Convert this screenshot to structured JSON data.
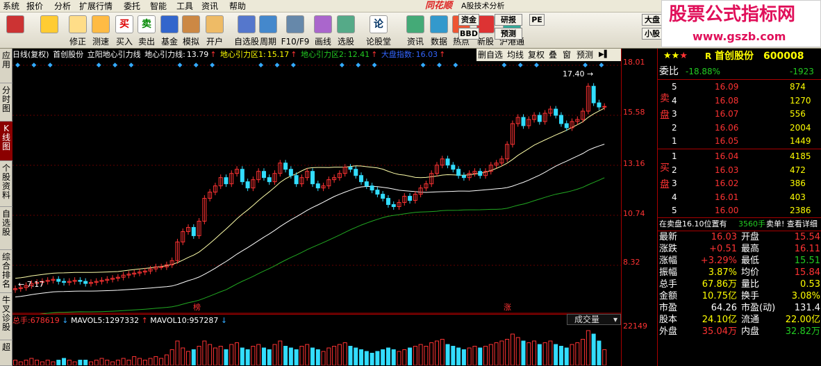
{
  "menu": [
    "系统",
    "报价",
    "分析",
    "扩展行情",
    "委托",
    "智能",
    "工具",
    "资讯",
    "帮助"
  ],
  "brand": "同花顺",
  "app_title": "A股技术分析",
  "toolbar": {
    "buttons": [
      {
        "label": "",
        "icon": "grid-icon"
      },
      {
        "label": "",
        "icon": "back-arrow-icon"
      },
      {
        "label": "修正",
        "icon": "arrows-icon"
      },
      {
        "label": "测速",
        "icon": "speed-icon"
      },
      {
        "label": "买入",
        "icon": "buy-icon",
        "glyph": "买"
      },
      {
        "label": "卖出",
        "icon": "sell-icon",
        "glyph": "卖"
      },
      {
        "label": "基金",
        "icon": "fund-icon"
      },
      {
        "label": "模拟",
        "icon": "hammer-icon"
      },
      {
        "label": "开户",
        "icon": "lock-icon"
      },
      {
        "label": "自选股",
        "icon": "star-icon"
      },
      {
        "label": "周期",
        "icon": "clock-icon"
      },
      {
        "label": "F10/F9",
        "icon": "f10-icon"
      },
      {
        "label": "画线",
        "icon": "pencil-icon"
      },
      {
        "label": "选股",
        "icon": "filter-icon"
      },
      {
        "label": "论股堂",
        "icon": "forum-icon",
        "glyph": "论"
      },
      {
        "label": "资讯",
        "icon": "news-icon"
      },
      {
        "label": "数据",
        "icon": "data-icon"
      },
      {
        "label": "热点",
        "icon": "hot-icon"
      },
      {
        "label": "新股",
        "icon": "newstock-icon"
      },
      {
        "label": "沪港通",
        "icon": "hk-icon"
      }
    ],
    "small": [
      "资金",
      "BBD",
      "研报",
      "预测",
      "PE",
      "大盘",
      "小股"
    ]
  },
  "watermark": {
    "line1": "股票公式指标网",
    "line2": "www.gszb.com"
  },
  "left_tabs": [
    "应用",
    "分时图",
    "K线图",
    "个股资料",
    "自选股",
    "综合排名",
    "牛叉诊股",
    "超"
  ],
  "chart_info": {
    "period": "日线(复权)",
    "stock": "首创股份",
    "indicator": "立阳地心引力线",
    "items": [
      {
        "label": "地心引力线:",
        "value": "13.79",
        "color": "#ffffff"
      },
      {
        "label": "地心引力区1:",
        "value": "15.17",
        "color": "#ffff00"
      },
      {
        "label": "地心引力区2:",
        "value": "12.41",
        "color": "#22cc22"
      },
      {
        "label": "大盘指数:",
        "value": "16.03",
        "color": "#3366ff"
      }
    ]
  },
  "chart_tools": [
    "删自选",
    "均线",
    "复权",
    "叠",
    "窗",
    "预测"
  ],
  "y_axis": [
    "18.01",
    "15.58",
    "13.16",
    "10.74",
    "8.32"
  ],
  "vol_y": "22149",
  "chart_data": {
    "type": "candlestick",
    "high_label": "17.40",
    "low_label": "7.17",
    "markers": [
      "榜",
      "涨"
    ],
    "ylim": [
      7.17,
      18.01
    ],
    "close": [
      7.25,
      7.3,
      7.4,
      7.5,
      7.55,
      7.6,
      7.65,
      7.7,
      7.6,
      7.55,
      7.6,
      7.65,
      7.6,
      7.5,
      7.55,
      7.6,
      7.65,
      7.7,
      7.75,
      7.8,
      7.9,
      7.95,
      8.0,
      8.05,
      8.1,
      8.2,
      8.3,
      8.3,
      8.4,
      8.6,
      9.5,
      10.0,
      10.2,
      9.8,
      10.5,
      11.6,
      11.9,
      12.2,
      12.6,
      12.3,
      12.8,
      13.0,
      12.4,
      12.1,
      12.5,
      12.9,
      12.6,
      12.4,
      12.8,
      13.3,
      13.0,
      12.7,
      12.3,
      12.6,
      12.9,
      12.3,
      12.1,
      12.2,
      12.5,
      12.6,
      12.8,
      13.1,
      13.0,
      12.7,
      12.4,
      12.2,
      12.0,
      11.8,
      11.6,
      11.3,
      11.2,
      11.4,
      11.7,
      11.5,
      11.8,
      12.1,
      12.3,
      12.8,
      13.2,
      13.5,
      13.2,
      13.0,
      12.7,
      12.6,
      12.8,
      12.9,
      12.7,
      12.9,
      13.2,
      13.3,
      13.5,
      14.2,
      15.2,
      15.5,
      15.1,
      15.4,
      15.6,
      15.3,
      15.7,
      15.9,
      15.6,
      15.2,
      15.0,
      15.3,
      15.4,
      15.8,
      17.0,
      16.2,
      16.0,
      16.03
    ],
    "volume": [
      3,
      2,
      3,
      4,
      3,
      2,
      3,
      2,
      3,
      4,
      3,
      2,
      3,
      3,
      2,
      3,
      4,
      3,
      2,
      3,
      4,
      3,
      5,
      4,
      3,
      4,
      5,
      4,
      6,
      9,
      14,
      10,
      8,
      9,
      11,
      14,
      12,
      10,
      11,
      9,
      12,
      13,
      10,
      9,
      11,
      12,
      10,
      9,
      12,
      14,
      11,
      10,
      9,
      11,
      12,
      10,
      9,
      8,
      10,
      11,
      12,
      13,
      11,
      10,
      9,
      8,
      7,
      8,
      9,
      10,
      9,
      8,
      9,
      10,
      11,
      12,
      11,
      13,
      14,
      15,
      12,
      11,
      10,
      9,
      10,
      11,
      10,
      11,
      12,
      13,
      14,
      15,
      18,
      16,
      14,
      13,
      14,
      12,
      13,
      14,
      12,
      11,
      10,
      12,
      13,
      15,
      20,
      18,
      14,
      9
    ]
  },
  "volume_info": {
    "total_label": "总手:",
    "total": "678619",
    "mavol5_label": "MAVOL5:",
    "mavol5": "1297332",
    "mavol10_label": "MAVOL10:",
    "mavol10": "957287"
  },
  "vol_dropdown": "成交量",
  "quote": {
    "name": "首创股份",
    "code": "600008",
    "prefix": "R",
    "weibi_label": "委比",
    "weibi": "-18.88%",
    "weicha": "-1923",
    "sell_side": "卖盘",
    "buy_side": "买盘",
    "sell": [
      {
        "lv": "5",
        "price": "16.09",
        "vol": "874"
      },
      {
        "lv": "4",
        "price": "16.08",
        "vol": "1270"
      },
      {
        "lv": "3",
        "price": "16.07",
        "vol": "556"
      },
      {
        "lv": "2",
        "price": "16.06",
        "vol": "2004"
      },
      {
        "lv": "1",
        "price": "16.05",
        "vol": "1449"
      }
    ],
    "buy": [
      {
        "lv": "1",
        "price": "16.04",
        "vol": "4185"
      },
      {
        "lv": "2",
        "price": "16.03",
        "vol": "472"
      },
      {
        "lv": "3",
        "price": "16.02",
        "vol": "386"
      },
      {
        "lv": "4",
        "price": "16.01",
        "vol": "403"
      },
      {
        "lv": "5",
        "price": "16.00",
        "vol": "2386"
      }
    ],
    "notice": "在卖盘16.10位置有",
    "notice_vol": "3560手",
    "notice_tail": "卖单! 查看详细",
    "stats": [
      {
        "l1": "最新",
        "v1": "16.03",
        "c1": "#ff3333",
        "l2": "开盘",
        "v2": "15.54",
        "c2": "#ff3333"
      },
      {
        "l1": "涨跌",
        "v1": "+0.51",
        "c1": "#ff3333",
        "l2": "最高",
        "v2": "16.11",
        "c2": "#ff3333"
      },
      {
        "l1": "涨幅",
        "v1": "+3.29%",
        "c1": "#ff3333",
        "l2": "最低",
        "v2": "15.51",
        "c2": "#22cc22"
      },
      {
        "l1": "振幅",
        "v1": "3.87%",
        "c1": "#ffff00",
        "l2": "均价",
        "v2": "15.84",
        "c2": "#ff3333"
      },
      {
        "l1": "总手",
        "v1": "67.86万",
        "c1": "#ffff00",
        "l2": "量比",
        "v2": "0.53",
        "c2": "#ffff00"
      },
      {
        "l1": "金额",
        "v1": "10.75亿",
        "c1": "#ffff00",
        "l2": "换手",
        "v2": "3.08%",
        "c2": "#ffff00"
      },
      {
        "l1": "市盈",
        "v1": "64.26",
        "c1": "#ffffff",
        "l2": "市盈(动)",
        "v2": "131.4",
        "c2": "#ffffff"
      },
      {
        "l1": "股本",
        "v1": "24.10亿",
        "c1": "#ffff00",
        "l2": "流通",
        "v2": "22.00亿",
        "c2": "#ffff00"
      },
      {
        "l1": "外盘",
        "v1": "35.04万",
        "c1": "#ff3333",
        "l2": "内盘",
        "v2": "32.82万",
        "c2": "#22cc22"
      }
    ]
  }
}
